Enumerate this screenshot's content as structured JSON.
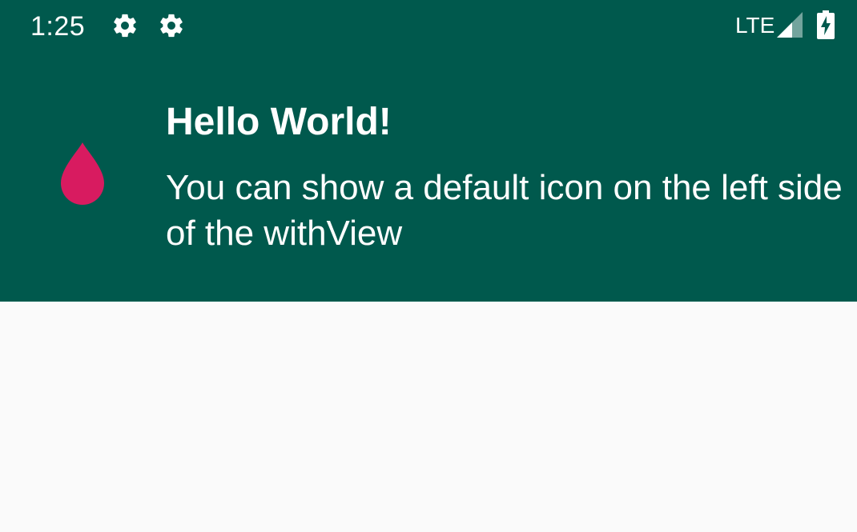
{
  "status_bar": {
    "time": "1:25",
    "network": "LTE",
    "icons": [
      "gear-icon",
      "gear-icon",
      "signal-icon",
      "battery-charging-icon"
    ]
  },
  "notification": {
    "title": "Hello World!",
    "message": "You can show a default icon on the left side of the withView",
    "icon": "drop-icon",
    "icon_color": "#d81b60",
    "background_color": "#00594d"
  }
}
